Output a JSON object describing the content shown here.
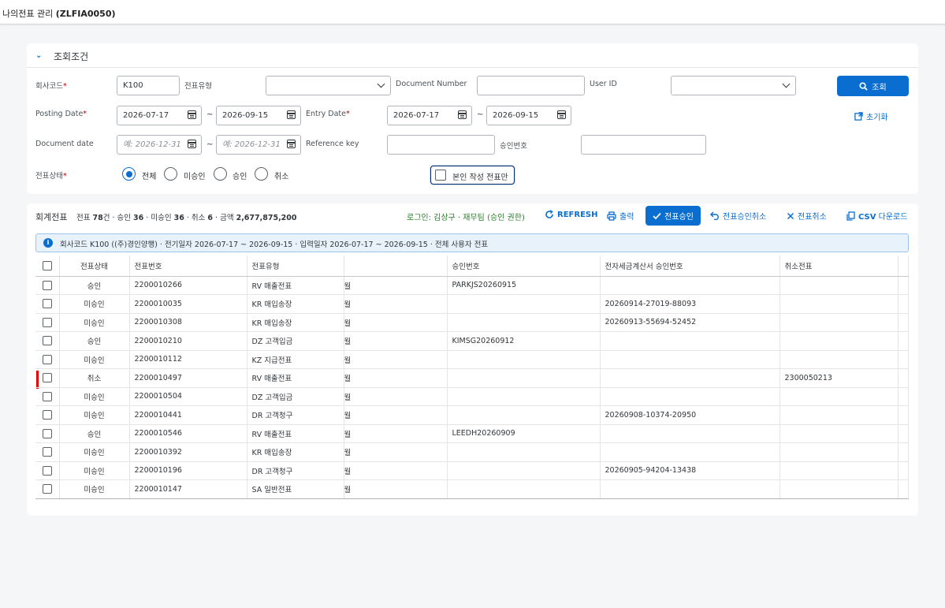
{
  "header": {
    "title_prefix": "나의전표 관리 ",
    "title_code": "(ZLFIA0050)"
  },
  "filter": {
    "section_label": "조회조건",
    "company_code": {
      "label": "회사코드",
      "value": "K100"
    },
    "doc_type": {
      "label": "전표유형",
      "value": ""
    },
    "doc_number": {
      "label": "Document Number",
      "value": ""
    },
    "user_id": {
      "label": "User ID",
      "value": ""
    },
    "search_button": "조회",
    "posting_date": {
      "label": "Posting Date",
      "from": "2026-07-17",
      "to": "2026-09-15"
    },
    "entry_date": {
      "label": "Entry Date",
      "from": "2026-07-17",
      "to": "2026-09-15"
    },
    "reset_button": "초기화",
    "document_date": {
      "label": "Document date",
      "from_placeholder": "예: 2026-12-31",
      "to_placeholder": "예: 2026-12-31"
    },
    "reference_key": {
      "label": "Reference key",
      "value": ""
    },
    "approval_no": {
      "label": "승인번호",
      "value": ""
    },
    "status": {
      "label": "전표상태",
      "options": [
        "전체",
        "미승인",
        "승인",
        "취소"
      ],
      "selected": "전체"
    },
    "own_only_label": "본인 작성 전표만",
    "tilde": "~"
  },
  "table": {
    "title": "회계전표",
    "summary": {
      "p1": "전표 ",
      "total": "78",
      "p2": "건 · 승인 ",
      "approved": "36",
      "p3": " · 미승인 ",
      "pending": "36",
      "p4": " · 취소 ",
      "cancelled": "6",
      "p5": " · 금액 ",
      "amount": "2,677,875,200"
    },
    "login": "로그인: 김상구 · 재무팀 (승인 권한)",
    "toolbar": {
      "refresh": "REFRESH",
      "print": "출력",
      "approve": "전표승인",
      "approve_cancel": "전표승인취소",
      "cancel": "전표취소",
      "csv_bold": "CSV",
      "csv_rest": " 다운로드"
    },
    "info": "회사코드 K100 ((주)경인양행) · 전기일자 2026-07-17 ~ 2026-09-15 · 입력일자 2026-07-17 ~ 2026-09-15 · 전체 사용자 전표",
    "columns": [
      "전표상태",
      "전표번호",
      "전표유형",
      "",
      "승인번호",
      "전자세금계산서 승인번호",
      "취소전표"
    ],
    "rows": [
      {
        "status": "승인",
        "kind": "ok",
        "number": "2200010266",
        "type": "RV 매출전표",
        "frag": "월",
        "approval": "PARKJS20260915",
        "tax": "",
        "cancel_doc": ""
      },
      {
        "status": "미승인",
        "kind": "pend",
        "number": "2200010035",
        "type": "KR 매입송장",
        "frag": "월",
        "approval": "",
        "tax": "20260914-27019-88093",
        "cancel_doc": ""
      },
      {
        "status": "미승인",
        "kind": "pend",
        "number": "2200010308",
        "type": "KR 매입송장",
        "frag": "월",
        "approval": "",
        "tax": "20260913-55694-52452",
        "cancel_doc": ""
      },
      {
        "status": "승인",
        "kind": "ok",
        "number": "2200010210",
        "type": "DZ 고객입금",
        "frag": "월",
        "approval": "KIMSG20260912",
        "tax": "",
        "cancel_doc": ""
      },
      {
        "status": "미승인",
        "kind": "pend",
        "number": "2200010112",
        "type": "KZ 지급전표",
        "frag": "월",
        "approval": "",
        "tax": "",
        "cancel_doc": ""
      },
      {
        "status": "취소",
        "kind": "cancel",
        "number": "2200010497",
        "type": "RV 매출전표",
        "frag": "월",
        "approval": "",
        "tax": "",
        "cancel_doc": "2300050213"
      },
      {
        "status": "미승인",
        "kind": "pend",
        "number": "2200010504",
        "type": "DZ 고객입금",
        "frag": "월",
        "approval": "",
        "tax": "",
        "cancel_doc": ""
      },
      {
        "status": "미승인",
        "kind": "pend",
        "number": "2200010441",
        "type": "DR 고객청구",
        "frag": "월",
        "approval": "",
        "tax": "20260908-10374-20950",
        "cancel_doc": ""
      },
      {
        "status": "승인",
        "kind": "ok",
        "number": "2200010546",
        "type": "RV 매출전표",
        "frag": "월",
        "approval": "LEEDH20260909",
        "tax": "",
        "cancel_doc": ""
      },
      {
        "status": "미승인",
        "kind": "pend",
        "number": "2200010392",
        "type": "KR 매입송장",
        "frag": "월",
        "approval": "",
        "tax": "",
        "cancel_doc": ""
      },
      {
        "status": "미승인",
        "kind": "pend",
        "number": "2200010196",
        "type": "DR 고객청구",
        "frag": "월",
        "approval": "",
        "tax": "20260905-94204-13438",
        "cancel_doc": ""
      },
      {
        "status": "미승인",
        "kind": "pend",
        "number": "2200010147",
        "type": "SA 일반전표",
        "frag": "월",
        "approval": "",
        "tax": "",
        "cancel_doc": ""
      }
    ]
  },
  "colors": {
    "accent": "#0a6ed1",
    "approved": "#2b7d2b",
    "pending": "#c35500",
    "cancelled": "#bb0000"
  }
}
